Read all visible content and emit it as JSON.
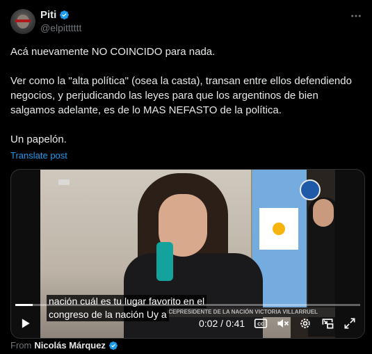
{
  "author": {
    "name": "Piti",
    "handle": "@elpitttttt"
  },
  "post": {
    "text": "Acá nuevamente NO COINCIDO para nada.\n\nVer como la \"alta política\" (osea la casta), transan entre ellos defendiendo negocios, y perjudicando las leyes para que los argentinos de bien salgamos adelante, es de lo MAS NEFASTO de la política.\n\nUn papelón.",
    "translate_label": "Translate post"
  },
  "video": {
    "caption_line1": "nación cuál es tu lugar favorito en el",
    "caption_line2": "congreso de la nación Uy a",
    "lower_third": "ICEPRESIDENTE DE LA NACIÓN VICTORIA VILLARRUEL",
    "time": "0:02 / 0:41",
    "progress_fraction": 0.05
  },
  "from": {
    "label": "From",
    "name": "Nicolás Márquez"
  },
  "colors": {
    "accent": "#1d9bf0",
    "muted": "#71767b",
    "background": "#000000"
  },
  "icons": [
    "verified-badge-icon",
    "more-icon",
    "play-icon",
    "captions-icon",
    "mute-icon",
    "settings-icon",
    "pip-icon",
    "fullscreen-icon"
  ]
}
